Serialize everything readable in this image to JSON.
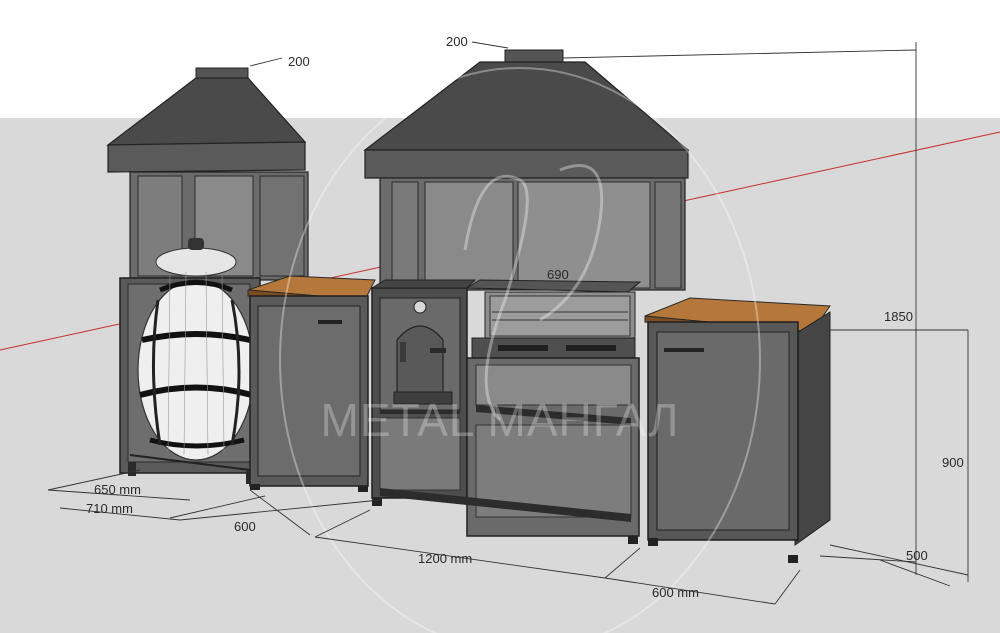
{
  "dimensions": {
    "chimney_left": "200",
    "chimney_right": "200",
    "grill_width": "690",
    "total_height": "1850",
    "counter_height": "900",
    "depth_right": "500",
    "depth_650": "650 mm",
    "depth_710": "710 mm",
    "width_600_left": "600",
    "width_1200": "1200 mm",
    "width_600_right": "600 mm"
  },
  "watermark": {
    "text": "METAL МАНГАЛ"
  },
  "colors": {
    "ground": "#d9d9d9",
    "metal_dark": "#4d4d4d",
    "metal_mid": "#5e5e5e",
    "metal_light": "#7a7a7a",
    "wood_top": "#b5783a",
    "axis_red": "#c8302a",
    "dim_line": "#333333"
  }
}
